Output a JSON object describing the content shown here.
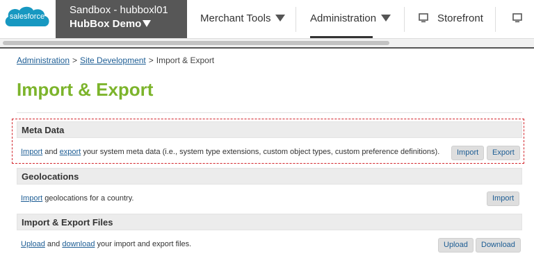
{
  "header": {
    "logo_text": "salesforce",
    "logo_color": "#1798c1",
    "sandbox_name": "Sandbox - hubboxl01",
    "site_name": "HubBox Demo",
    "nav": [
      {
        "label": "Merchant Tools",
        "has_caret": true,
        "active": false
      },
      {
        "label": "Administration",
        "has_caret": true,
        "active": true
      },
      {
        "label": "Storefront",
        "icon": "monitor-icon",
        "active": false
      }
    ]
  },
  "breadcrumb": {
    "items": [
      "Administration",
      "Site Development"
    ],
    "current": "Import & Export",
    "separator": ">"
  },
  "page": {
    "title": "Import & Export",
    "title_color": "#7cb42b"
  },
  "sections": {
    "meta": {
      "title": "Meta Data",
      "link1": "Import",
      "and": "and",
      "link2": "export",
      "rest": "your system meta data (i.e., system type extensions, custom object types, custom preference definitions).",
      "btn1": "Import",
      "btn2": "Export"
    },
    "geo": {
      "title": "Geolocations",
      "link1": "Import",
      "rest": "geolocations for a country.",
      "btn1": "Import"
    },
    "files": {
      "title": "Import & Export Files",
      "link1": "Upload",
      "and": "and",
      "link2": "download",
      "rest": "your import and export files.",
      "btn1": "Upload",
      "btn2": "Download"
    }
  },
  "colors": {
    "link": "#1d5d94",
    "highlight_border": "#d2232a",
    "sandbox_bg": "#575757"
  }
}
